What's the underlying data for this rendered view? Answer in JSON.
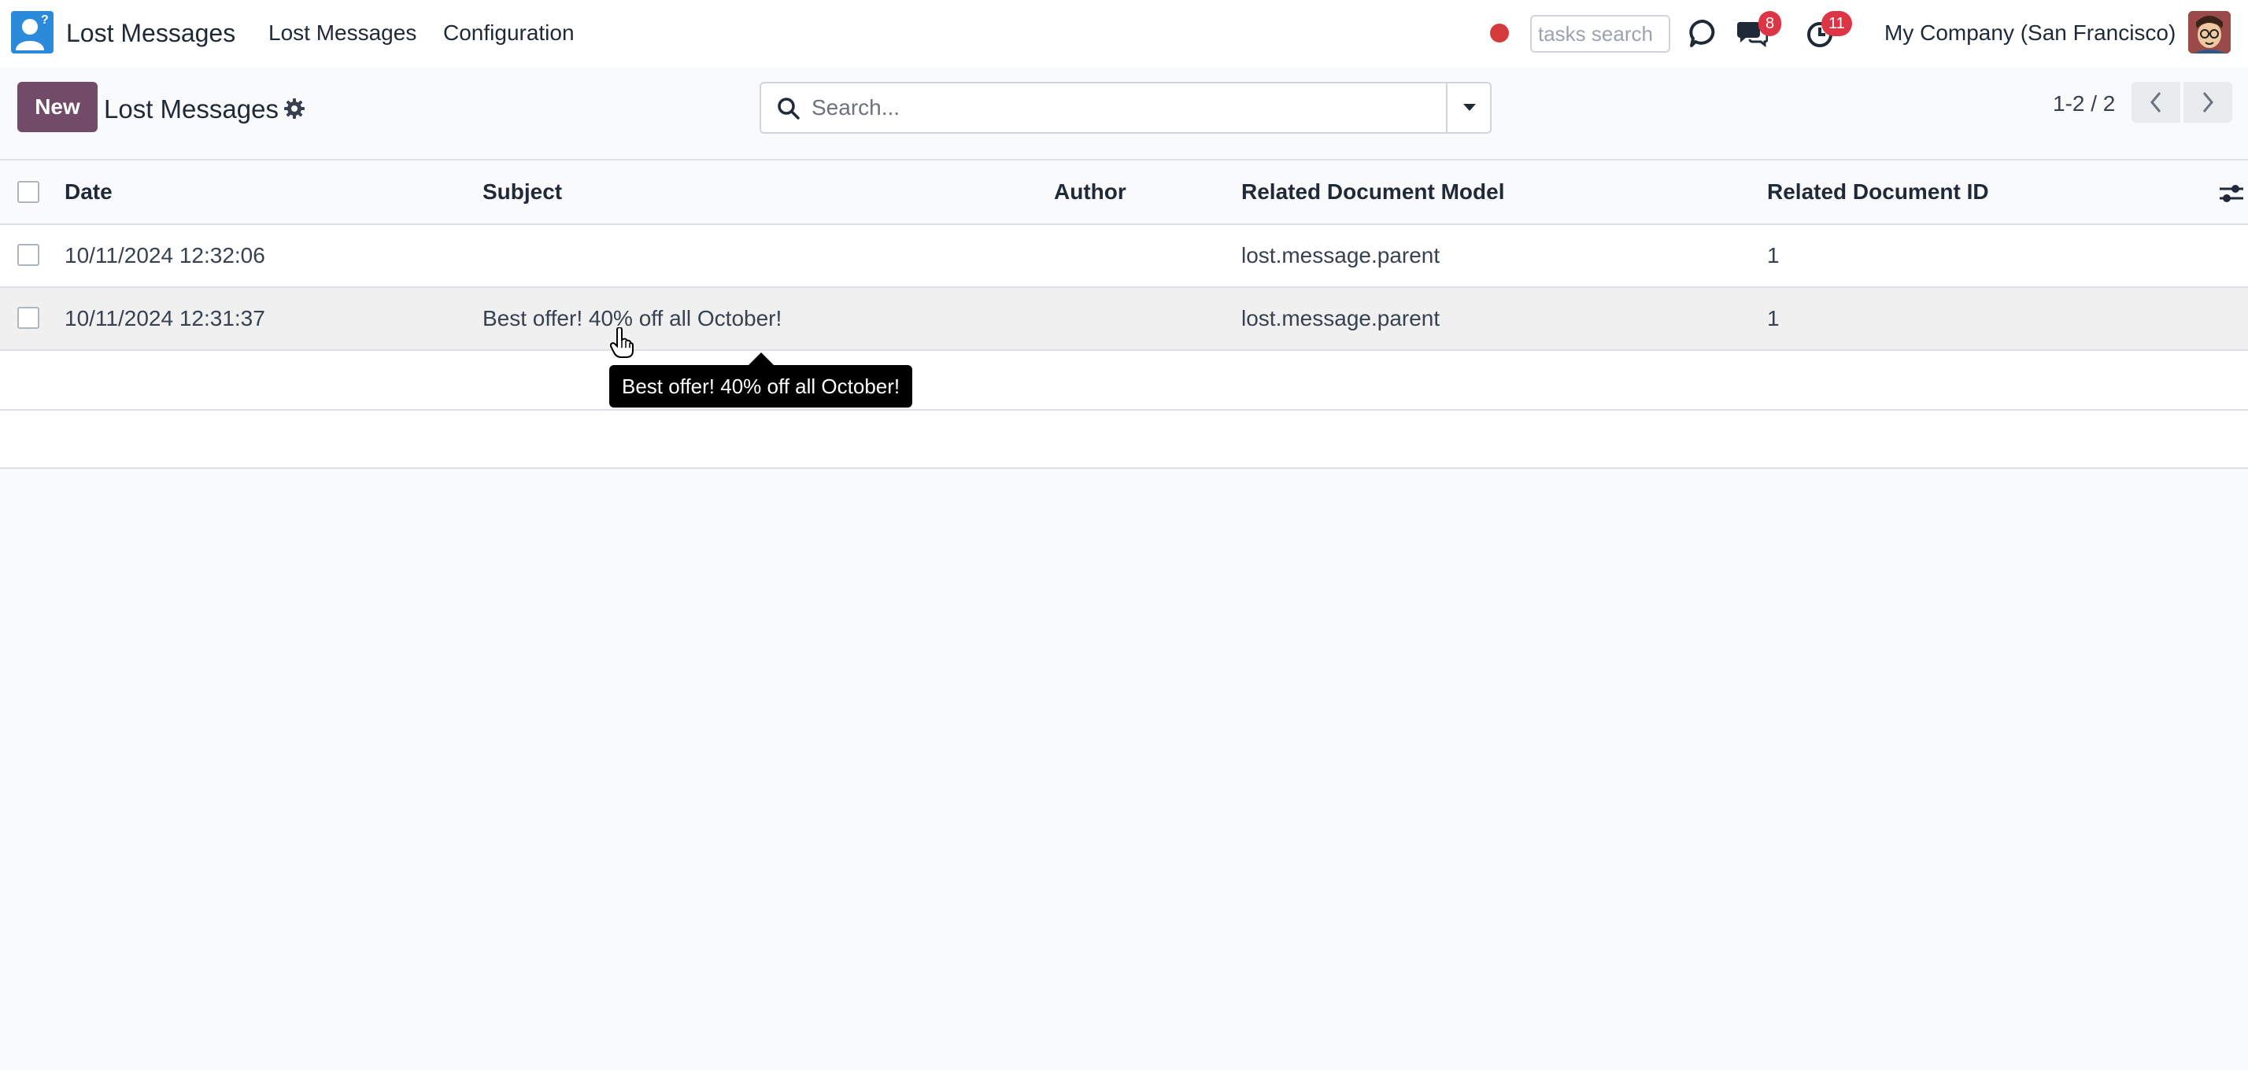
{
  "navbar": {
    "app_title": "Lost Messages",
    "menu": [
      {
        "label": "Lost Messages"
      },
      {
        "label": "Configuration"
      }
    ],
    "tasks_search_placeholder": "tasks search",
    "messages_badge": "8",
    "activities_badge": "11",
    "company": "My Company (San Francisco)"
  },
  "control_panel": {
    "new_label": "New",
    "title": "Lost Messages",
    "search_placeholder": "Search...",
    "pager": "1-2 / 2"
  },
  "table": {
    "columns": [
      "Date",
      "Subject",
      "Author",
      "Related Document Model",
      "Related Document ID"
    ],
    "rows": [
      {
        "date": "10/11/2024 12:32:06",
        "subject": "",
        "author": "",
        "model": "lost.message.parent",
        "res_id": "1"
      },
      {
        "date": "10/11/2024 12:31:37",
        "subject": "Best offer! 40% off all October!",
        "author": "",
        "model": "lost.message.parent",
        "res_id": "1"
      }
    ]
  },
  "tooltip": {
    "text": "Best offer! 40% off all October!"
  },
  "colors": {
    "brand": "#714b67",
    "app_icon": "#2b8ad9",
    "badge": "#dc3545",
    "record_dot": "#d43a3a"
  }
}
